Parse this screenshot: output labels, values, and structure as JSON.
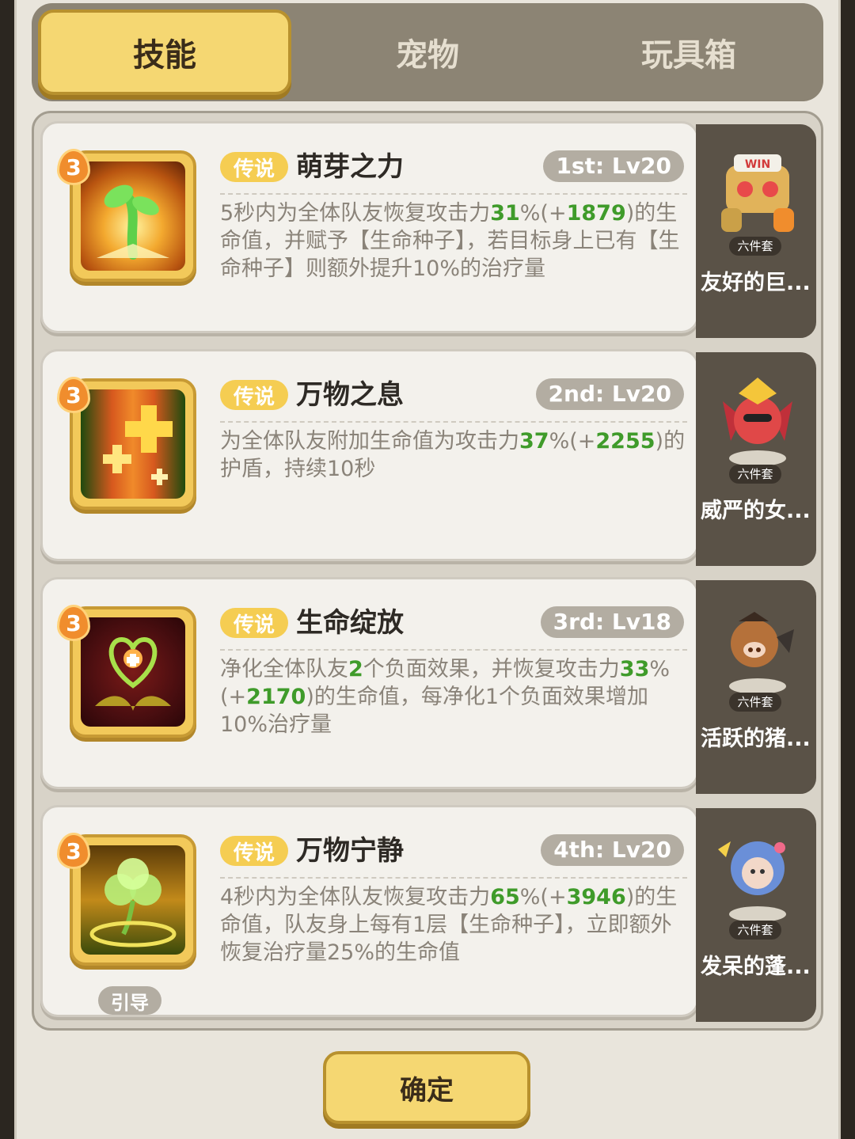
{
  "tabs": {
    "skill": "技能",
    "pet": "宠物",
    "toybox": "玩具箱"
  },
  "skills": [
    {
      "level": "3",
      "tag": "传说",
      "name": "萌芽之力",
      "slot": "1st: Lv20",
      "desc": [
        {
          "t": "5秒内为全体队友恢复攻击力"
        },
        {
          "t": "31",
          "g": true
        },
        {
          "t": "%(+"
        },
        {
          "t": "1879",
          "g": true
        },
        {
          "t": ")的生命值，并赋予【生命种子】，若目标身上已有【生命种子】则额外提升10%的治疗量"
        }
      ],
      "pet_name": "友好的巨...",
      "set_label": "六件套"
    },
    {
      "level": "3",
      "tag": "传说",
      "name": "万物之息",
      "slot": "2nd: Lv20",
      "desc": [
        {
          "t": "为全体队友附加生命值为攻击力"
        },
        {
          "t": "37",
          "g": true
        },
        {
          "t": "%(+"
        },
        {
          "t": "2255",
          "g": true
        },
        {
          "t": ")的护盾，持续10秒"
        }
      ],
      "pet_name": "威严的女...",
      "set_label": "六件套"
    },
    {
      "level": "3",
      "tag": "传说",
      "name": "生命绽放",
      "slot": "3rd: Lv18",
      "desc": [
        {
          "t": "净化全体队友"
        },
        {
          "t": "2",
          "g": true
        },
        {
          "t": "个负面效果，并恢复攻击力"
        },
        {
          "t": "33",
          "g": true
        },
        {
          "t": "%(+"
        },
        {
          "t": "2170",
          "g": true
        },
        {
          "t": ")的生命值，每净化1个负面效果增加10%治疗量"
        }
      ],
      "pet_name": "活跃的猪...",
      "set_label": "六件套"
    },
    {
      "level": "3",
      "tag": "传说",
      "name": "万物宁静",
      "slot": "4th: Lv20",
      "desc": [
        {
          "t": "4秒内为全体队友恢复攻击力"
        },
        {
          "t": "65",
          "g": true
        },
        {
          "t": "%(+"
        },
        {
          "t": "3946",
          "g": true
        },
        {
          "t": ")的生命值，队友身上每有1层【生命种子】，立即额外恢复治疗量25%的生命值"
        }
      ],
      "pet_name": "发呆的蓬...",
      "set_label": "六件套",
      "guide": "引导"
    }
  ],
  "confirm": "确定"
}
